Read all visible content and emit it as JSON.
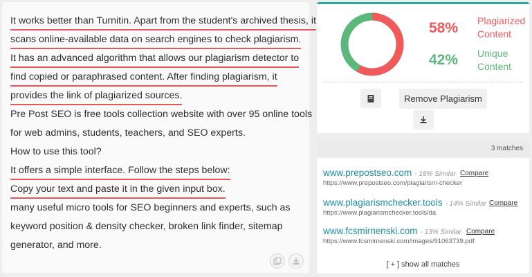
{
  "text_panel": {
    "lines": [
      {
        "text": "It works better than Turnitin. Apart from the student's archived thesis, it",
        "plagiarized": true
      },
      {
        "text": "scans online-available data on search engines to check plagiarism.",
        "plagiarized": true
      },
      {
        "text": "It has an advanced algorithm that allows our plagiarism detector to",
        "plagiarized": true
      },
      {
        "text": "find copied or paraphrased content. After finding plagiarism, it",
        "plagiarized": true
      },
      {
        "text": "provides the link of plagiarized sources.",
        "plagiarized": true
      },
      {
        "text": "Pre Post SEO is free tools collection website with over 95 online tools",
        "plagiarized": false
      },
      {
        "text": "for web admins, students, teachers, and SEO experts.",
        "plagiarized": false
      },
      {
        "text": "How to use this tool?",
        "plagiarized": false
      },
      {
        "text": "It offers a simple interface. Follow the steps below:",
        "plagiarized": true
      },
      {
        "text": "Copy your text and paste it in the given input box.",
        "plagiarized": true
      },
      {
        "text": "many useful micro tools for SEO beginners and experts, such as",
        "plagiarized": false
      },
      {
        "text": "keyword position & density checker, broken link finder, sitemap",
        "plagiarized": false
      },
      {
        "text": "generator, and more.",
        "plagiarized": false
      }
    ],
    "bottom_icons": [
      "copy-icon",
      "download-icon"
    ]
  },
  "result": {
    "plagiarized_percent": "58%",
    "plagiarized_label_line1": "Plagiarized",
    "plagiarized_label_line2": "Content",
    "unique_percent": "42%",
    "unique_label_line1": "Unique",
    "unique_label_line2": "Content",
    "plagiarized_value": 58,
    "unique_value": 42,
    "colors": {
      "plagiarized": "#f05a5b",
      "unique": "#5cb87a",
      "accent": "#2aa7a0"
    },
    "remove_button_label": "Remove Plagiarism",
    "book_icon": "book-icon",
    "download_icon": "download-icon"
  },
  "matches": {
    "count_label": "3 matches",
    "items": [
      {
        "site": "www.prepostseo.com",
        "similarity": "- 18% Similar",
        "compare": "Compare",
        "url": "https://www.prepostseo.com/plagiarism-checker"
      },
      {
        "site": "www.plagiarismchecker.tools",
        "similarity": "- 14% Similar",
        "compare": "Compare",
        "url": "https://www.plagiarismchecker.tools/da"
      },
      {
        "site": "www.fcsmirnenski.com",
        "similarity": "- 13% Similar",
        "compare": "Compare",
        "url": "https://www.fcsmirnenski.com/images/91063739.pdf"
      }
    ],
    "show_all_label": "[ + ] show all matches"
  }
}
